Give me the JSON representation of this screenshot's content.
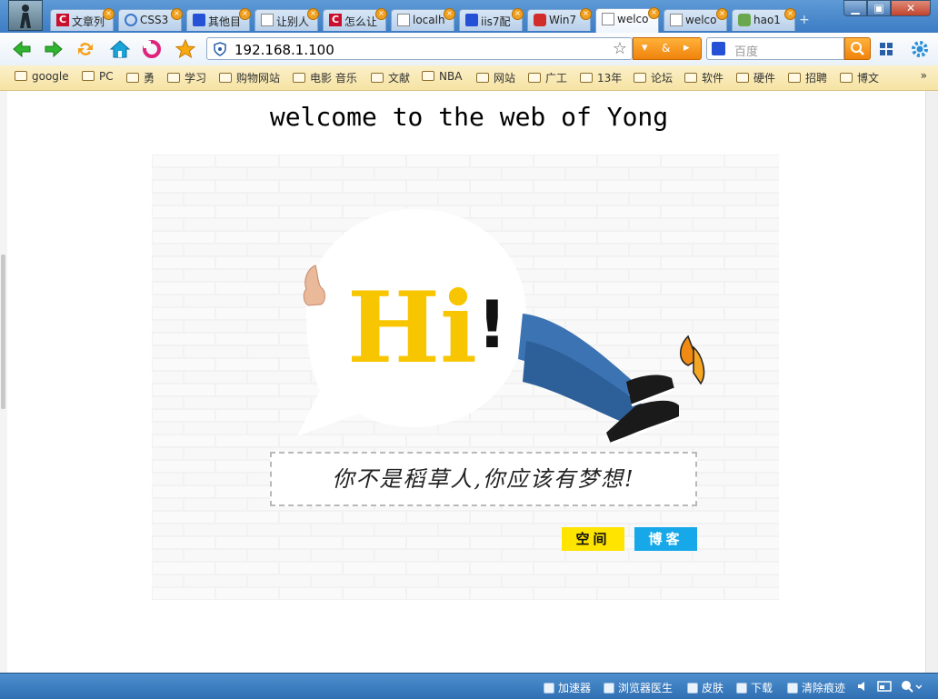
{
  "tabs": [
    {
      "label": "文章列",
      "icon": "c-logo-icon"
    },
    {
      "label": "CSS3",
      "icon": "ie-icon"
    },
    {
      "label": "其他目",
      "icon": "paw-icon"
    },
    {
      "label": "让别人",
      "icon": "doc-icon"
    },
    {
      "label": "怎么让",
      "icon": "c-logo-icon"
    },
    {
      "label": "localh",
      "icon": "doc-icon"
    },
    {
      "label": "iis7配",
      "icon": "paw-icon"
    },
    {
      "label": "Win7",
      "icon": "redhat-icon"
    },
    {
      "label": "welco",
      "icon": "doc-icon",
      "active": true
    },
    {
      "label": "welco",
      "icon": "doc-icon"
    },
    {
      "label": "hao1",
      "icon": "leaf-icon"
    }
  ],
  "tab_close_glyph": "×",
  "new_tab_glyph": "+",
  "window": {
    "minimize": "▁",
    "maximize": "▣",
    "close": "✕"
  },
  "address": {
    "url": "192.168.1.100",
    "star": "☆"
  },
  "address_drop": {
    "arrow": "▾",
    "amp": "&",
    "go": "▸"
  },
  "search": {
    "placeholder": "百度"
  },
  "bookmarks": [
    "google",
    "PC",
    "勇",
    "学习",
    "购物网站",
    "电影 音乐",
    "文献",
    "NBA",
    "网站",
    "广工",
    "13年",
    "论坛",
    "软件",
    "硬件",
    "招聘",
    "博文"
  ],
  "bookmarks_more": "»",
  "page": {
    "title": "welcome to the web of Yong",
    "hero_text": "Hi",
    "hero_excl": "!",
    "quote": "你不是稻草人,你应该有梦想!",
    "btn_space": "空间",
    "btn_blog": "博客"
  },
  "status": {
    "accelerate": "加速器",
    "doctor": "浏览器医生",
    "skin": "皮肤",
    "download": "下载",
    "clear": "清除痕迹"
  },
  "colors": {
    "accent_orange": "#f0830c",
    "hi_yellow": "#f7c600",
    "btn_yellow": "#ffe400",
    "btn_blue": "#16a8e8"
  }
}
